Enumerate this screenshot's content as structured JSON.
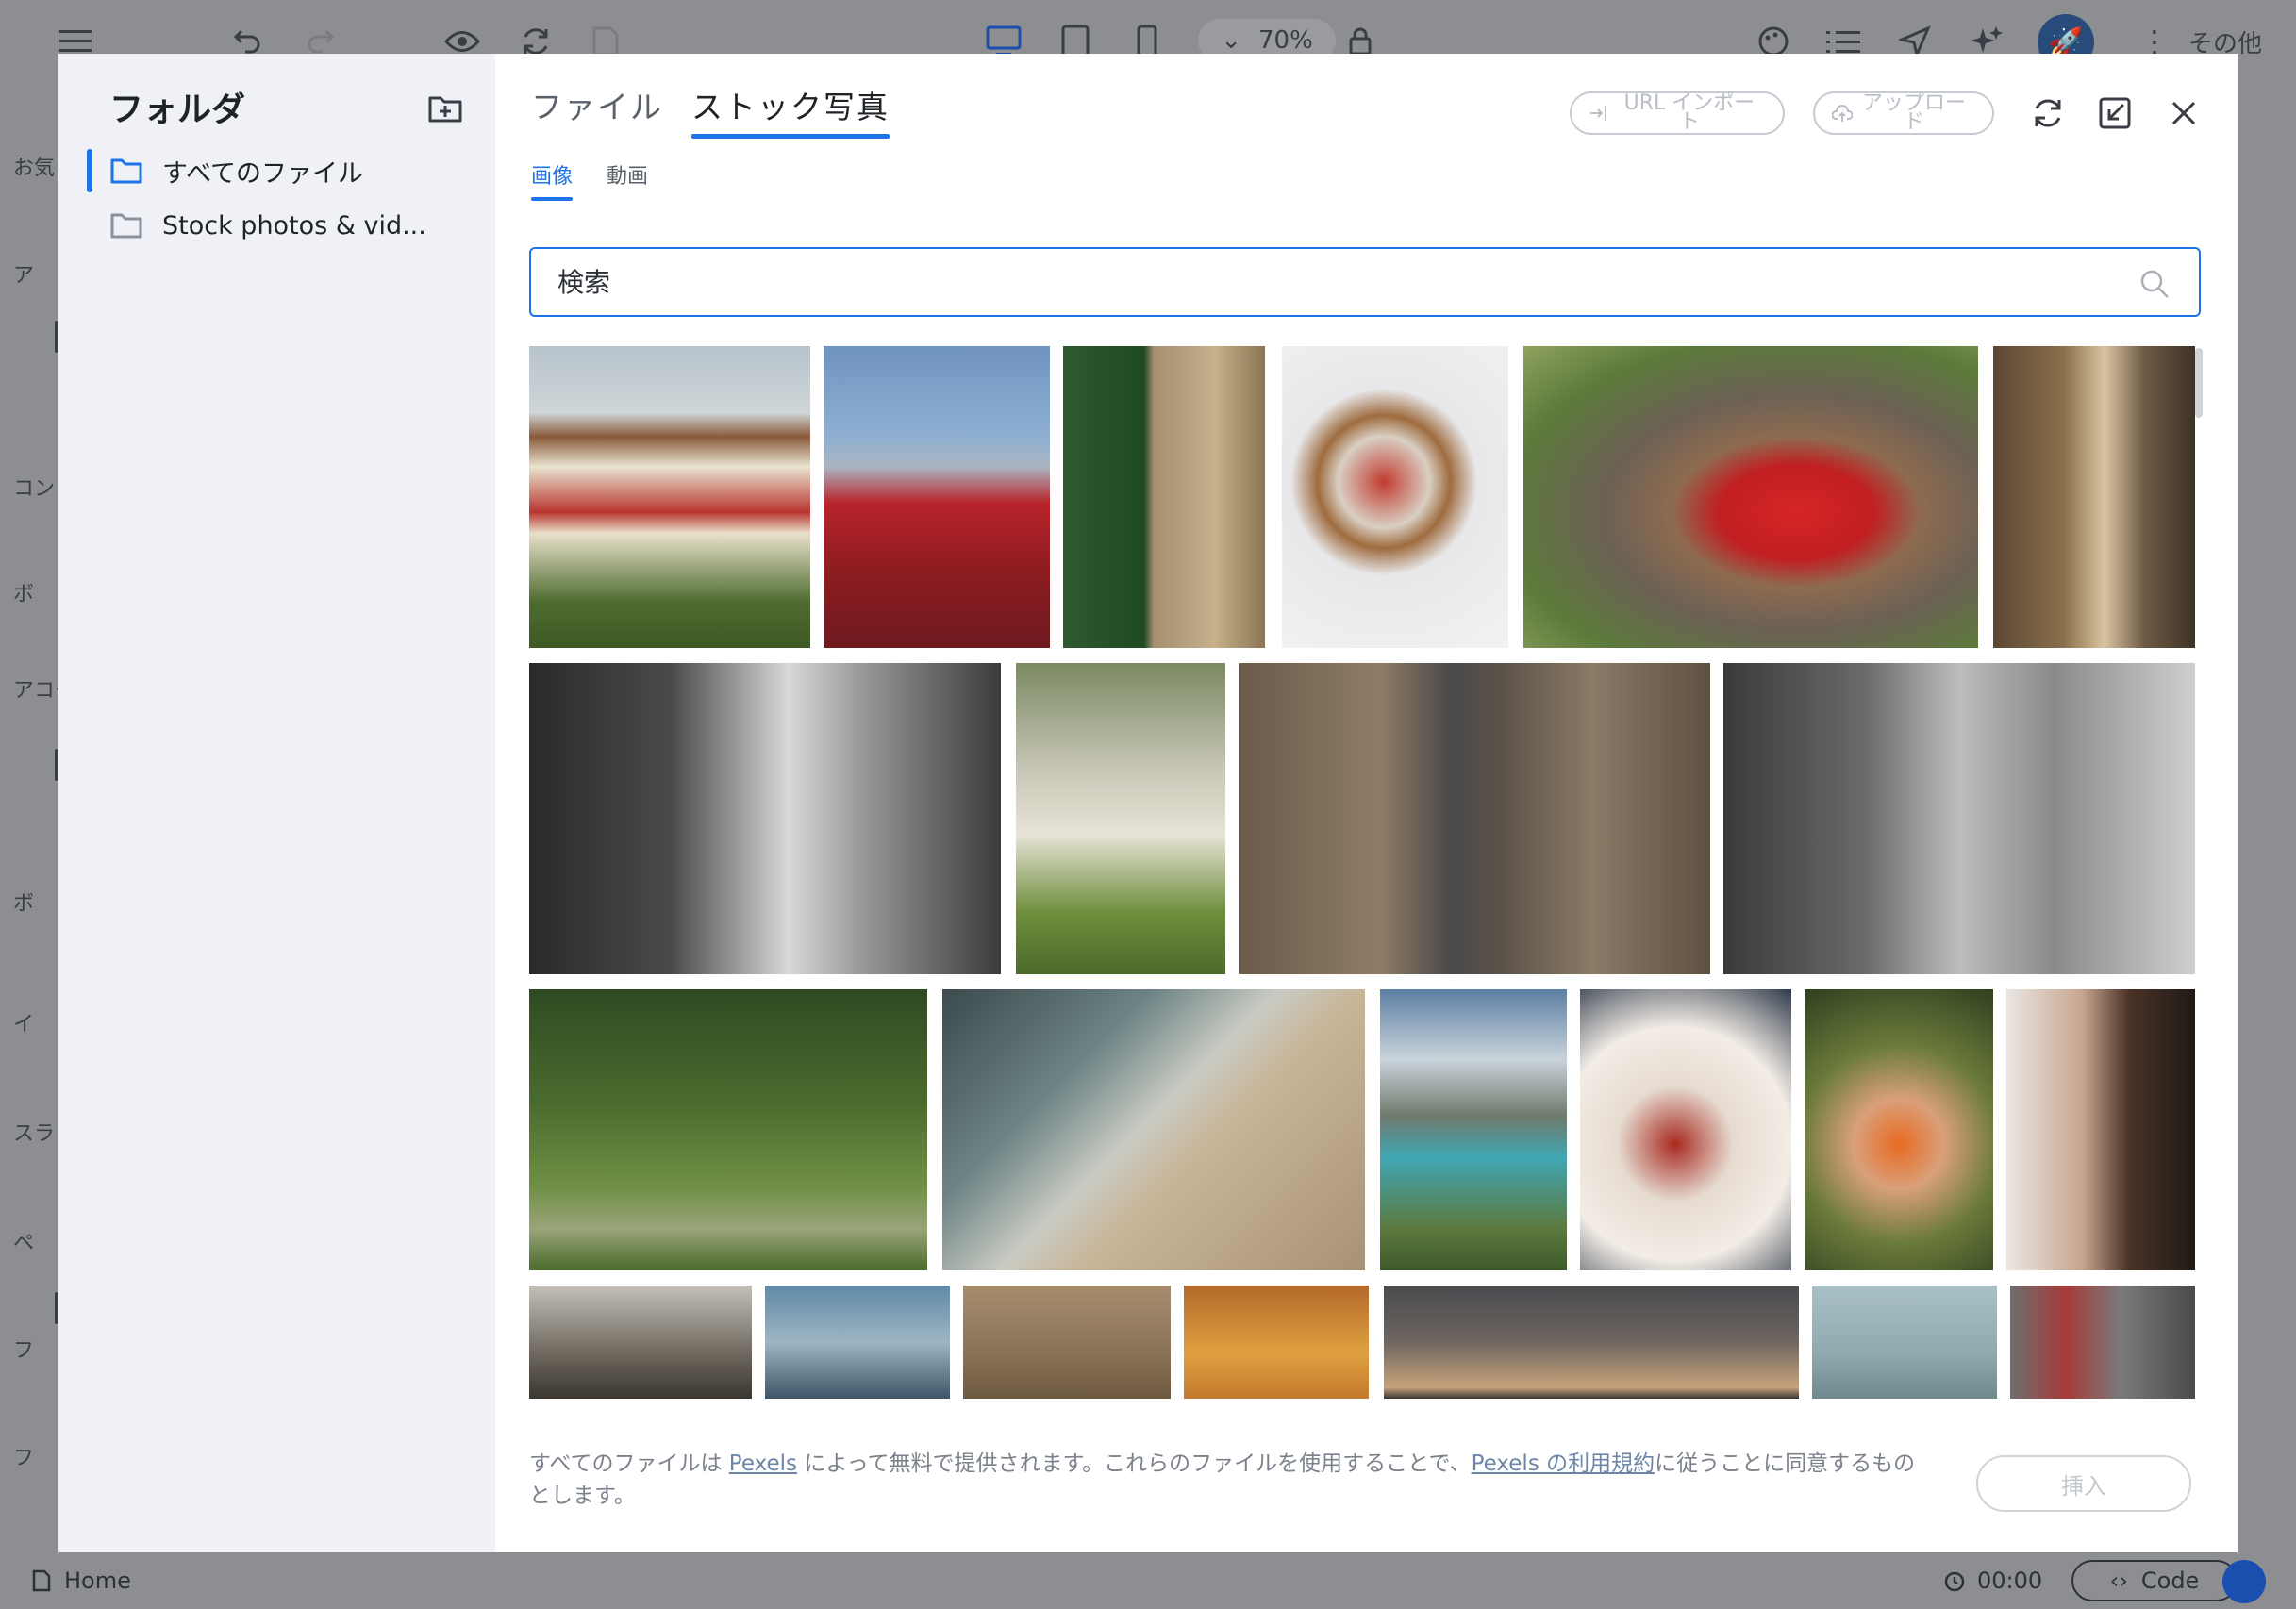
{
  "editor": {
    "zoom_label": "70%",
    "more_label": "その他",
    "left_labels": [
      "お気",
      "ア",
      "コン",
      "ボ",
      "アコー",
      "ボ",
      "イ",
      "スラ",
      "ペ",
      "フ",
      "フ"
    ],
    "bottom": {
      "page": "Home",
      "time": "00:00",
      "code_label": "Code"
    }
  },
  "sidebar": {
    "title": "フォルダ",
    "items": [
      {
        "label": "すべてのファイル",
        "active": true
      },
      {
        "label": "Stock photos & vid..."
      }
    ]
  },
  "header": {
    "tabs": [
      {
        "label": "ファイル",
        "active": false
      },
      {
        "label": "ストック写真",
        "active": true
      }
    ],
    "url_import": "URL インポート",
    "upload": "アップロード"
  },
  "subtabs": [
    {
      "label": "画像",
      "active": true
    },
    {
      "label": "動画",
      "active": false
    }
  ],
  "search": {
    "placeholder": "検索"
  },
  "footer": {
    "text_1": "すべてのファイルは ",
    "link_1": "Pexels",
    "text_2": " によって無料で提供されます。これらのファイルを使用することで、",
    "link_2": "Pexels の利用規約",
    "text_3": "に従うことに同意するものとします。",
    "insert_label": "挿入"
  },
  "colors": {
    "accent": "#1e73e8",
    "sidebar_bg": "#eff1f7",
    "overlay": "#8d8e91"
  }
}
